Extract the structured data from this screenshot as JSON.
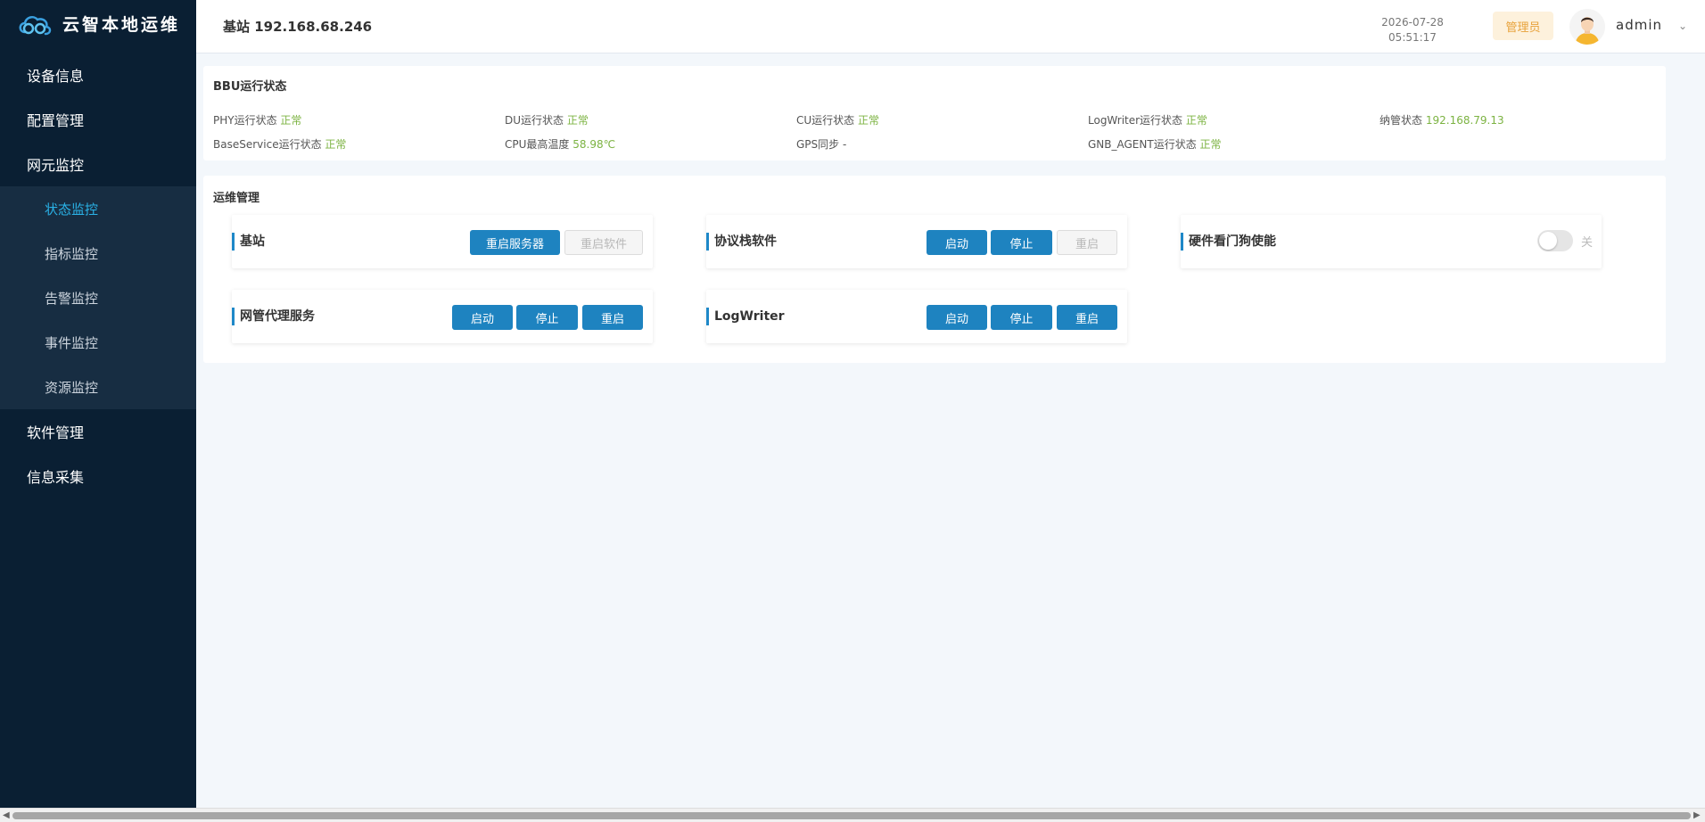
{
  "app": {
    "title": "云智本地运维"
  },
  "sidebar": {
    "items": [
      {
        "label": "设备信息"
      },
      {
        "label": "配置管理"
      },
      {
        "label": "网元监控"
      },
      {
        "label": "软件管理"
      },
      {
        "label": "信息采集"
      }
    ],
    "subitems": [
      {
        "label": "状态监控",
        "active": true
      },
      {
        "label": "指标监控"
      },
      {
        "label": "告警监控"
      },
      {
        "label": "事件监控"
      },
      {
        "label": "资源监控"
      }
    ]
  },
  "header": {
    "title": "基站 192.168.68.246",
    "date": "2026-07-28",
    "time": "05:51:17",
    "role": "管理员",
    "username": "admin",
    "caret": "⌄"
  },
  "bbu": {
    "title": "BBU运行状态",
    "items": [
      {
        "label": "PHY运行状态",
        "value": "正常"
      },
      {
        "label": "DU运行状态",
        "value": "正常"
      },
      {
        "label": "CU运行状态",
        "value": "正常"
      },
      {
        "label": "LogWriter运行状态",
        "value": "正常"
      },
      {
        "label": "纳管状态",
        "value": "192.168.79.13"
      },
      {
        "label": "BaseService运行状态",
        "value": "正常"
      },
      {
        "label": "CPU最高温度",
        "value": "58.98℃"
      },
      {
        "label": "GPS同步",
        "value": "-"
      },
      {
        "label": "GNB_AGENT运行状态",
        "value": "正常"
      }
    ]
  },
  "ops": {
    "title": "运维管理",
    "station": {
      "label": "基站",
      "restart_server": "重启服务器",
      "restart_software": "重启软件"
    },
    "stack": {
      "label": "协议栈软件",
      "start": "启动",
      "stop": "停止",
      "restart": "重启"
    },
    "watchdog": {
      "label": "硬件看门狗使能",
      "state": "关",
      "enabled": false
    },
    "agent": {
      "label": "网管代理服务",
      "start": "启动",
      "stop": "停止",
      "restart": "重启"
    },
    "logwriter": {
      "label": "LogWriter",
      "start": "启动",
      "stop": "停止",
      "restart": "重启"
    }
  },
  "colors": {
    "sidebar_bg": "#0a1f33",
    "accent": "#1e83c0",
    "ok": "#7cb342",
    "active_nav": "#2ab3e8"
  }
}
